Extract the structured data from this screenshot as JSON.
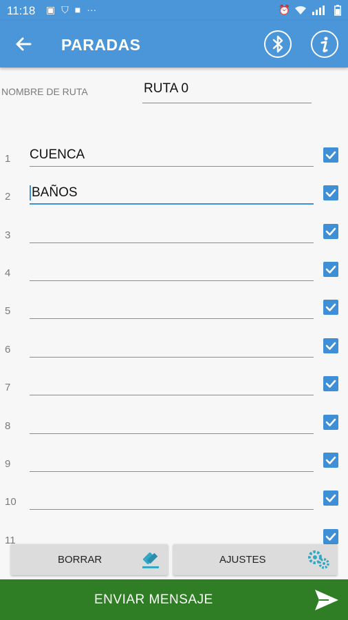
{
  "status_bar": {
    "time": "11:18",
    "more": "···"
  },
  "app_bar": {
    "title": "PARADAS"
  },
  "route": {
    "label": "NOMBRE DE RUTA",
    "value": "RUTA 0"
  },
  "stops": [
    {
      "number": "1",
      "value": "CUENCA",
      "checked": true
    },
    {
      "number": "2",
      "value": "BAÑOS",
      "checked": true
    },
    {
      "number": "3",
      "value": "",
      "checked": true
    },
    {
      "number": "4",
      "value": "",
      "checked": true
    },
    {
      "number": "5",
      "value": "",
      "checked": true
    },
    {
      "number": "6",
      "value": "",
      "checked": true
    },
    {
      "number": "7",
      "value": "",
      "checked": true
    },
    {
      "number": "8",
      "value": "",
      "checked": true
    },
    {
      "number": "9",
      "value": "",
      "checked": true
    },
    {
      "number": "10",
      "value": "",
      "checked": true
    },
    {
      "number": "11",
      "value": "",
      "checked": true
    }
  ],
  "actions": {
    "clear_label": "BORRAR",
    "settings_label": "AJUSTES"
  },
  "send": {
    "label": "ENVIAR MENSAJE"
  },
  "colors": {
    "primary": "#4a96d8",
    "send_bar": "#2f7d24",
    "checkbox": "#3f8fd6",
    "icon_accent": "#33a7c4"
  }
}
